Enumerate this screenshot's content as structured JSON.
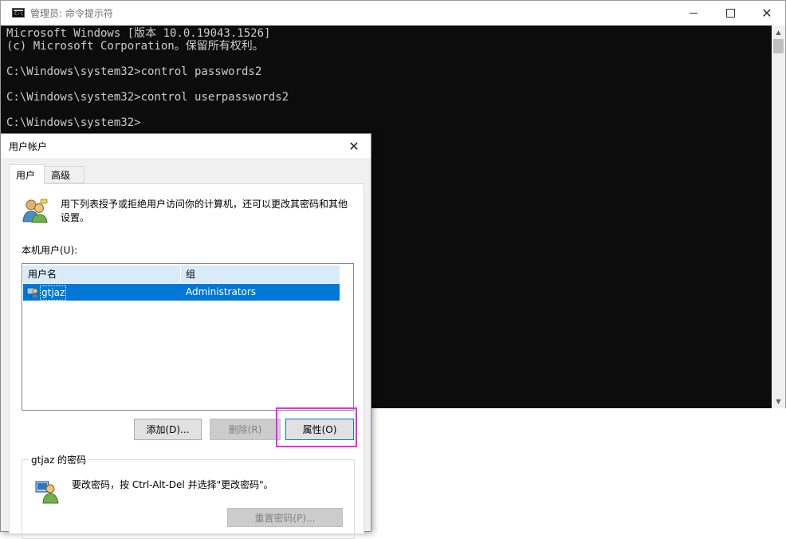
{
  "cmd": {
    "title": "管理员: 命令提示符",
    "icon_label": "C:\\",
    "lines": [
      "Microsoft Windows [版本 10.0.19043.1526]",
      "(c) Microsoft Corporation。保留所有权利。",
      "",
      "C:\\Windows\\system32>control passwords2",
      "",
      "C:\\Windows\\system32>control userpasswords2",
      "",
      "C:\\Windows\\system32>"
    ],
    "colors": {
      "background": "#0c0c0c",
      "text": "#cccccc"
    }
  },
  "dialog": {
    "title": "用户帐户",
    "tabs": [
      "用户",
      "高级"
    ],
    "intro": "用下列表授予或拒绝用户访问你的计算机，还可以更改其密码和其他设置。",
    "list_label": "本机用户(U):",
    "columns": [
      "用户名",
      "组"
    ],
    "rows": [
      {
        "user": "gtjaz",
        "group": "Administrators"
      }
    ],
    "buttons": {
      "add": "添加(D)...",
      "remove": "删除(R)",
      "properties": "属性(O)"
    },
    "password_group": {
      "label": "gtjaz 的密码",
      "text": "要改密码，按 Ctrl-Alt-Del 并选择\"更改密码\"。",
      "reset_button": "重置密码(P)..."
    }
  },
  "colors": {
    "selection": "#0078d7",
    "highlight_box": "#ea2be9",
    "header_bg": "#d9ebf9"
  }
}
